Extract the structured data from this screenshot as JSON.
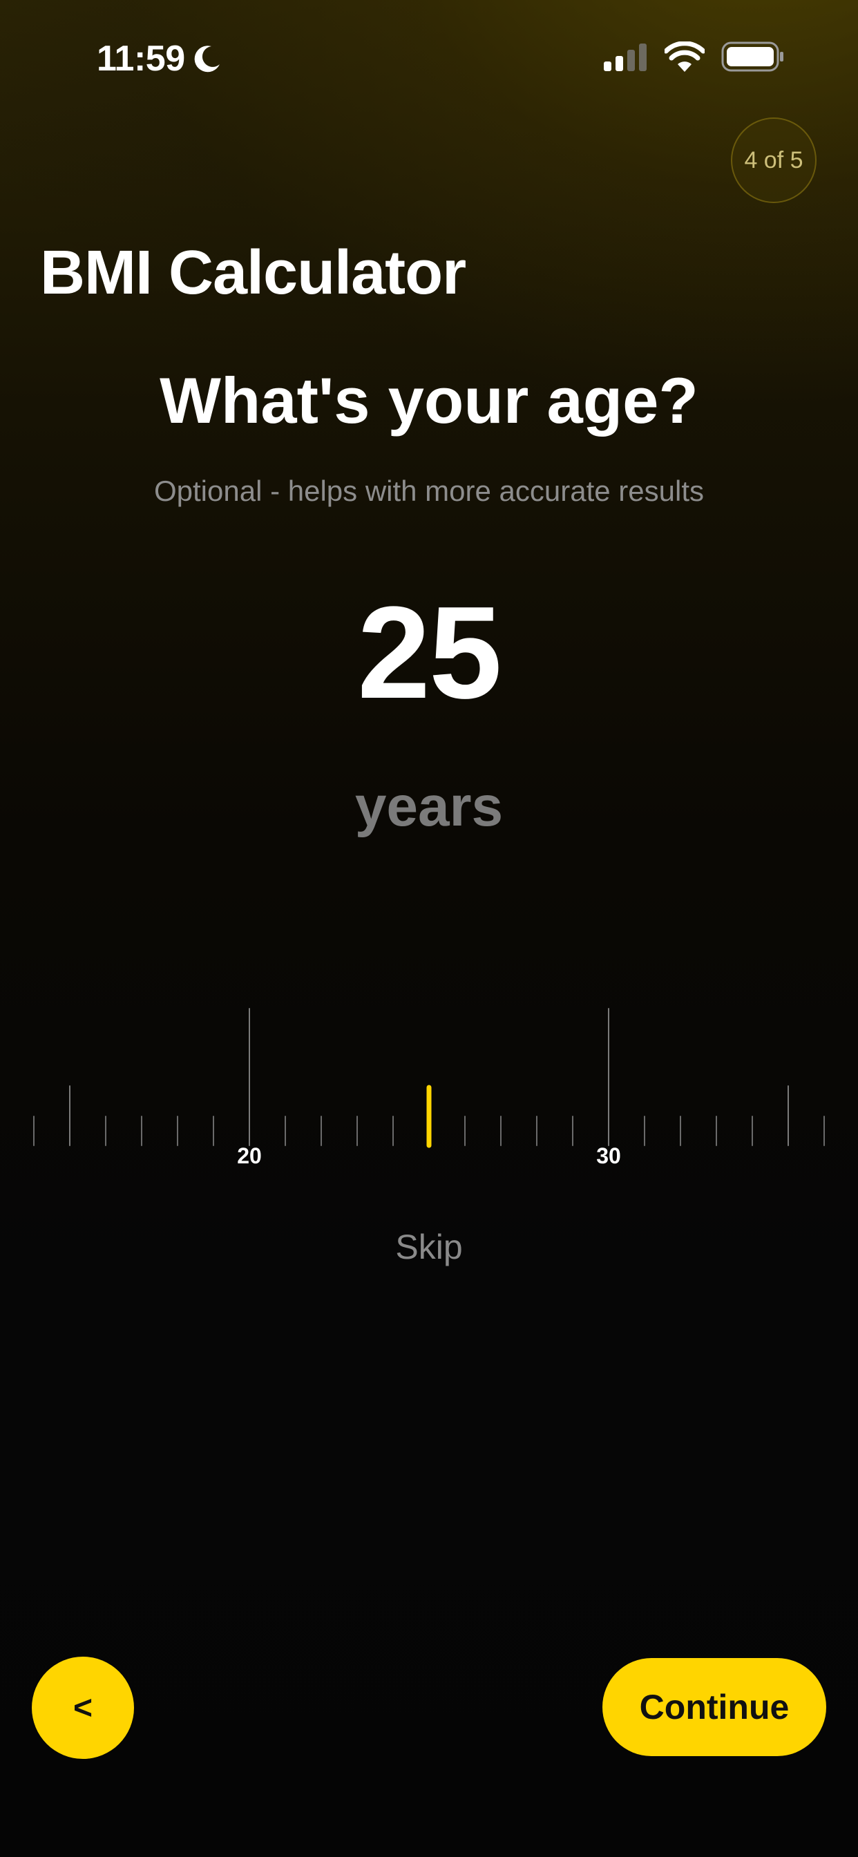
{
  "status_bar": {
    "time": "11:59",
    "icons": [
      "moon-icon",
      "cellular-signal-icon",
      "wifi-icon",
      "battery-icon"
    ]
  },
  "step_badge": "4 of 5",
  "app_title": "BMI Calculator",
  "question": "What's your age?",
  "subtitle": "Optional - helps with more accurate results",
  "age": {
    "value": "25",
    "unit": "years"
  },
  "ruler": {
    "selected": 25,
    "min_visible": 14,
    "max_visible": 36,
    "labels": [
      {
        "value": 20,
        "text": "20"
      },
      {
        "value": 30,
        "text": "30"
      }
    ]
  },
  "skip_label": "Skip",
  "back_label": "<",
  "continue_label": "Continue",
  "colors": {
    "accent": "#ffd500",
    "background": "#050505",
    "text_primary": "#ffffff",
    "text_secondary": "#8d8d8d"
  }
}
